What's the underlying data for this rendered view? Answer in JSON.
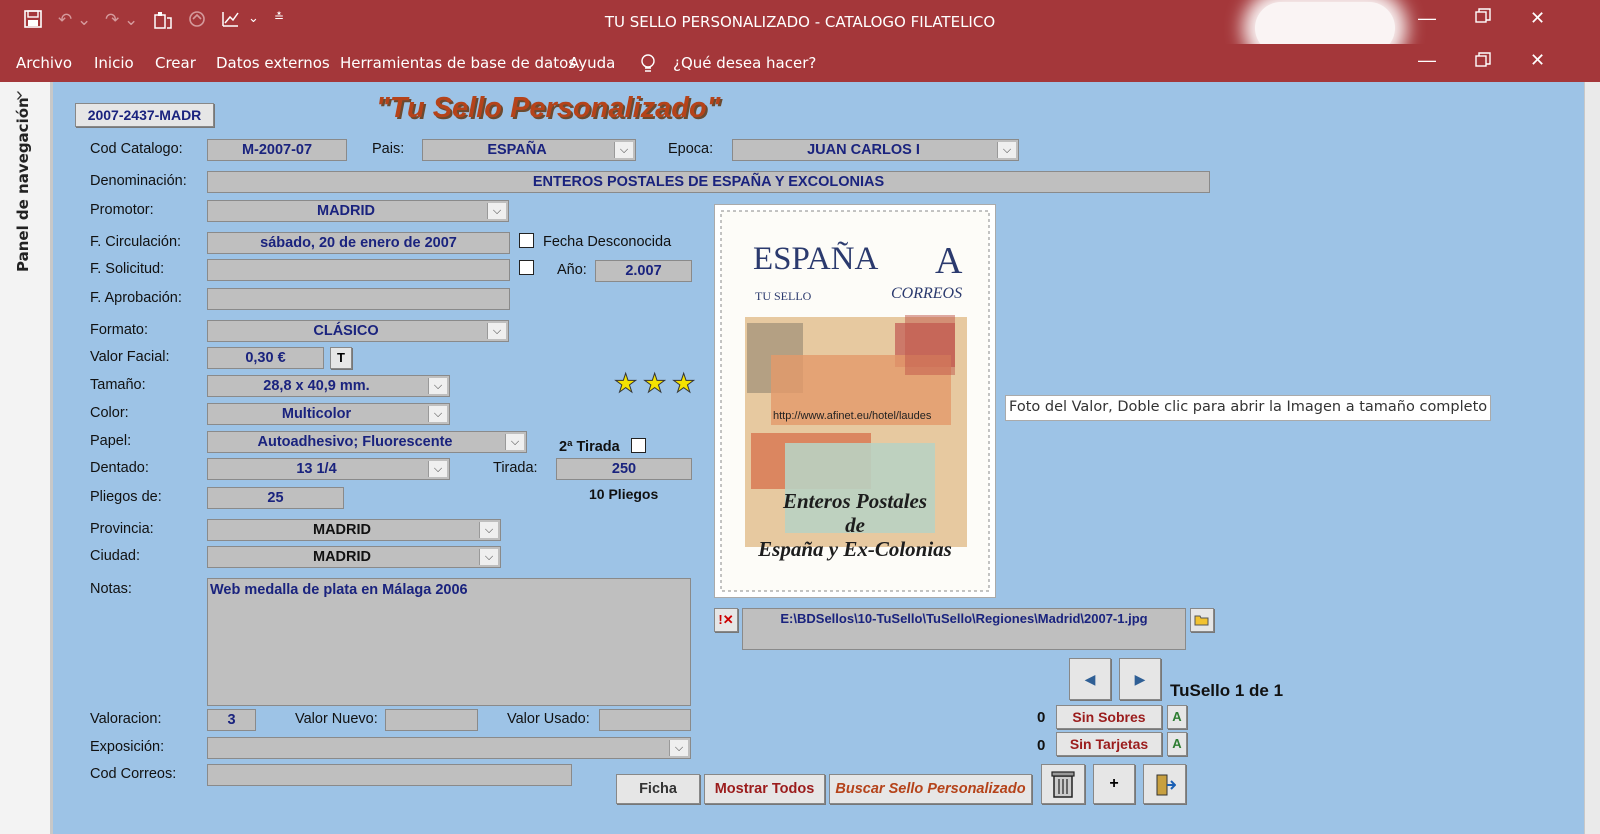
{
  "window": {
    "title": "TU SELLO PERSONALIZADO  -  CATALOGO FILATELICO"
  },
  "ribbon": {
    "menu": [
      "Archivo",
      "Inicio",
      "Crear",
      "Datos externos",
      "Herramientas de base de datos",
      "Ayuda"
    ],
    "search_placeholder": "¿Qué desea hacer?"
  },
  "nav_pane": {
    "label": "Panel de navegación"
  },
  "form": {
    "record_id": "2007-2437-MADR",
    "heading": "\"Tu Sello Personalizado\"",
    "cod_catalogo": {
      "label": "Cod Catalogo:",
      "value": "M-2007-07"
    },
    "pais": {
      "label": "Pais:",
      "value": "ESPAÑA"
    },
    "epoca": {
      "label": "Epoca:",
      "value": "JUAN CARLOS I"
    },
    "denominacion": {
      "label": "Denominación:",
      "value": "ENTEROS POSTALES DE ESPAÑA Y EXCOLONIAS"
    },
    "promotor": {
      "label": "Promotor:",
      "value": "MADRID"
    },
    "f_circulacion": {
      "label": "F. Circulación:",
      "value": "sábado, 20 de enero de 2007"
    },
    "fecha_desconocida": {
      "label": "Fecha Desconocida",
      "checked": false
    },
    "f_solicitud": {
      "label": "F. Solicitud:",
      "value": ""
    },
    "anio": {
      "label": "Año:",
      "value": "2.007"
    },
    "f_aprobacion": {
      "label": "F. Aprobación:",
      "value": ""
    },
    "formato": {
      "label": "Formato:",
      "value": "CLÁSICO"
    },
    "valor_facial": {
      "label": "Valor Facial:",
      "value": "0,30 €",
      "button": "T"
    },
    "tamano": {
      "label": "Tamaño:",
      "value": "28,8 x 40,9 mm."
    },
    "rating_stars": 3,
    "color": {
      "label": "Color:",
      "value": "Multicolor"
    },
    "papel": {
      "label": "Papel:",
      "value": "Autoadhesivo; Fluorescente"
    },
    "segunda_tirada": {
      "label": "2ª Tirada",
      "checked": false
    },
    "dentado": {
      "label": "Dentado:",
      "value": "13 1/4"
    },
    "tirada": {
      "label": "Tirada:",
      "value": "250",
      "pliegos_text": "10 Pliegos"
    },
    "pliegos_de": {
      "label": "Pliegos de:",
      "value": "25"
    },
    "provincia": {
      "label": "Provincia:",
      "value": "MADRID"
    },
    "ciudad": {
      "label": "Ciudad:",
      "value": "MADRID"
    },
    "notas": {
      "label": "Notas:",
      "value": "Web medalla de plata en Málaga 2006"
    },
    "valoracion": {
      "label": "Valoracion:",
      "value": "3"
    },
    "valor_nuevo": {
      "label": "Valor Nuevo:",
      "value": ""
    },
    "valor_usado": {
      "label": "Valor Usado:",
      "value": ""
    },
    "exposicion": {
      "label": "Exposición:",
      "value": ""
    },
    "cod_correos": {
      "label": "Cod Correos:",
      "value": ""
    }
  },
  "stamp_image": {
    "country": "ESPAÑA",
    "rate": "A",
    "brand": "TU SELLO",
    "post": "CORREOS",
    "url": "http://www.afinet.eu/hotel/laudes",
    "caption_line1": "Enteros Postales",
    "caption_line2": "de",
    "caption_line3": "España y Ex-Colonias",
    "tooltip": "Foto del Valor, Doble clic para abrir la Imagen a tamaño completo"
  },
  "image_path": "E:\\BDSellos\\10-TuSello\\TuSello\\Regiones\\Madrid\\2007-1.jpg",
  "navigation": {
    "record_text": "TuSello 1 de 1"
  },
  "sobres": {
    "count": "0",
    "label": "Sin Sobres",
    "add": "A"
  },
  "tarjetas": {
    "count": "0",
    "label": "Sin Tarjetas",
    "add": "A"
  },
  "actions": {
    "ficha": "Ficha",
    "mostrar_todos": "Mostrar Todos",
    "buscar": "Buscar Sello Personalizado",
    "nuevo": "+"
  }
}
